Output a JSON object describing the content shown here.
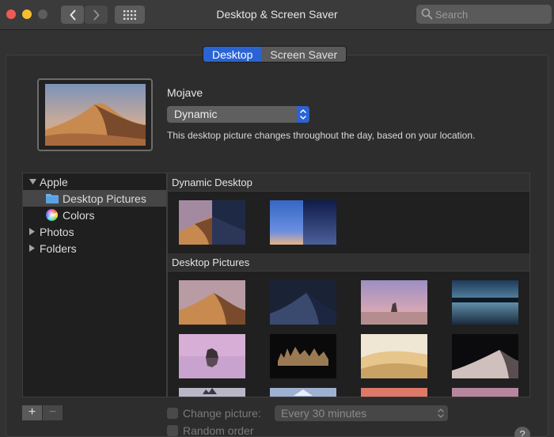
{
  "window": {
    "title": "Desktop & Screen Saver"
  },
  "search": {
    "placeholder": "Search"
  },
  "tabs": [
    {
      "label": "Desktop",
      "active": true
    },
    {
      "label": "Screen Saver",
      "active": false
    }
  ],
  "current": {
    "name": "Mojave",
    "mode": "Dynamic",
    "description": "This desktop picture changes throughout the day, based on your location."
  },
  "sidebar": {
    "items": [
      {
        "label": "Apple",
        "expanded": true
      },
      {
        "label": "Desktop Pictures",
        "selected": true,
        "icon": "folder-icon"
      },
      {
        "label": "Colors",
        "icon": "color-wheel-icon"
      },
      {
        "label": "Photos",
        "expanded": false
      },
      {
        "label": "Folders",
        "expanded": false
      }
    ]
  },
  "sections": {
    "dynamic": "Dynamic Desktop",
    "pictures": "Desktop Pictures"
  },
  "bottom": {
    "plus": "+",
    "minus": "−",
    "change_picture": "Change picture:",
    "interval": "Every 30 minutes",
    "random_order": "Random order",
    "help": "?"
  },
  "colors": {
    "accent": "#2a63d4",
    "close": "#ee5b54",
    "minimize": "#f6be2f"
  }
}
